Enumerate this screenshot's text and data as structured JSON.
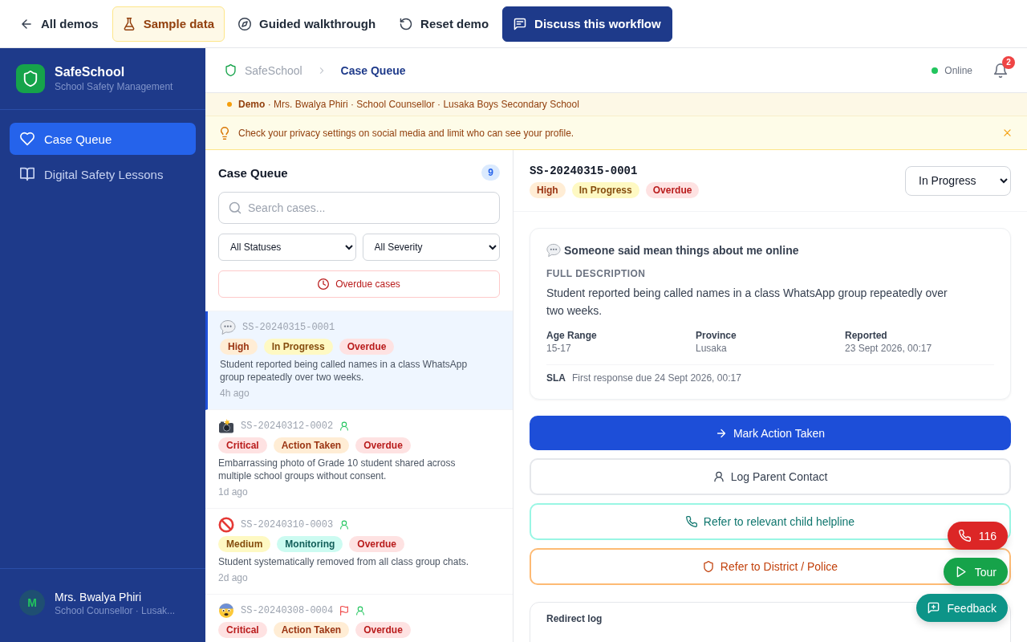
{
  "top_bar": {
    "items": [
      {
        "kind": "back",
        "label": "All demos"
      },
      {
        "kind": "sample",
        "label": "Sample data"
      },
      {
        "kind": "guide",
        "label": "Guided walkthrough"
      },
      {
        "kind": "reset",
        "label": "Reset demo"
      },
      {
        "kind": "discuss",
        "label": "Discuss this workflow"
      }
    ]
  },
  "sidebar": {
    "brand": {
      "name": "SafeSchool",
      "tagline": "School Safety Management"
    },
    "items": [
      {
        "kind": "queue",
        "label": "Case Queue",
        "selected": true
      },
      {
        "kind": "lessons",
        "label": "Digital Safety Lessons",
        "selected": false
      }
    ],
    "user": {
      "initial": "M",
      "name": "Mrs. Bwalya Phiri",
      "role": "School Counsellor · Lusak..."
    }
  },
  "header": {
    "breadcrumb": [
      "SafeSchool",
      "Case Queue"
    ],
    "online": true,
    "status": "Online",
    "notification_count": "2"
  },
  "demo_banner": {
    "text": "**Demo** · Mrs. Bwalya Phiri · School Counsellor · Lusaka Boys Secondary School"
  },
  "tip": {
    "text": "Check your privacy settings on social media and limit who can see your profile."
  },
  "queue": {
    "title": "Case Queue",
    "count": "9",
    "search": {
      "placeholder": "Search cases..."
    },
    "filters": [
      "All Statuses",
      "All Severity"
    ],
    "overdue_button": "Overdue cases",
    "cases": [
      {
        "kind": "chat",
        "id": "SS-20240315-0001",
        "selected": true,
        "assigned": false,
        "flagged": false,
        "tags": [
          {
            "label": "High",
            "color": "#ffedd5"
          },
          {
            "label": "In Progress",
            "color": "#fef9c3"
          },
          {
            "label": "Overdue",
            "color": "#fee2e2"
          }
        ],
        "summary": "Student reported being called names in a class WhatsApp group repeatedly over two weeks.",
        "time": "4h ago"
      },
      {
        "kind": "photo",
        "id": "SS-20240312-0002",
        "selected": false,
        "assigned": true,
        "flagged": false,
        "tags": [
          {
            "label": "Critical",
            "color": "#fee2e2"
          },
          {
            "label": "Action Taken",
            "color": "#ffedd5"
          },
          {
            "label": "Overdue",
            "color": "#fee2e2"
          }
        ],
        "summary": "Embarrassing photo of Grade 10 student shared across multiple school groups without consent.",
        "time": "1d ago"
      },
      {
        "kind": "exclusion",
        "id": "SS-20240310-0003",
        "selected": false,
        "assigned": true,
        "flagged": false,
        "tags": [
          {
            "label": "Medium",
            "color": "#fef9c3"
          },
          {
            "label": "Monitoring",
            "color": "#ccfbf1"
          },
          {
            "label": "Overdue",
            "color": "#fee2e2"
          }
        ],
        "summary": "Student systematically removed from all class group chats.",
        "time": "2d ago"
      },
      {
        "kind": "fear",
        "id": "SS-20240308-0004",
        "selected": false,
        "assigned": true,
        "flagged": true,
        "tags": [
          {
            "label": "Critical",
            "color": "#fee2e2"
          },
          {
            "label": "Action Taken",
            "color": "#ffedd5"
          },
          {
            "label": "Overdue",
            "color": "#fee2e2"
          }
        ]
      }
    ]
  },
  "detail": {
    "id": "SS-20240315-0001",
    "tags": [
      {
        "label": "High",
        "color": "#ffedd5"
      },
      {
        "label": "In Progress",
        "color": "#fef9c3"
      },
      {
        "label": "Overdue",
        "color": "#fee2e2"
      }
    ],
    "status_select": "In Progress",
    "card": {
      "kind": "chat",
      "title": "Someone said mean things about me online",
      "section_label": "FULL DESCRIPTION",
      "description": "Student reported being called names in a class WhatsApp group repeatedly over two weeks.",
      "facts": [
        {
          "label": "Age Range",
          "value": "15-17"
        },
        {
          "label": "Province",
          "value": "Lusaka"
        },
        {
          "label": "Reported",
          "value": "23 Sept 2026, 00:17"
        }
      ],
      "sla": {
        "label": "SLA",
        "text": "First response due 24 Sept 2026, 00:17"
      }
    },
    "actions": [
      {
        "kind": "primary",
        "label": "Mark Action Taken"
      },
      {
        "kind": "contact",
        "label": "Log Parent Contact"
      },
      {
        "kind": "helpline",
        "label": "Refer to relevant child helpline"
      },
      {
        "kind": "police",
        "label": "Refer to District / Police"
      }
    ],
    "redirect_log": {
      "title": "Redirect log"
    }
  },
  "floating_buttons": [
    {
      "kind": "emergency",
      "label": "116"
    },
    {
      "kind": "tour",
      "label": "Tour"
    },
    {
      "kind": "feedback",
      "label": "Feedback"
    }
  ]
}
